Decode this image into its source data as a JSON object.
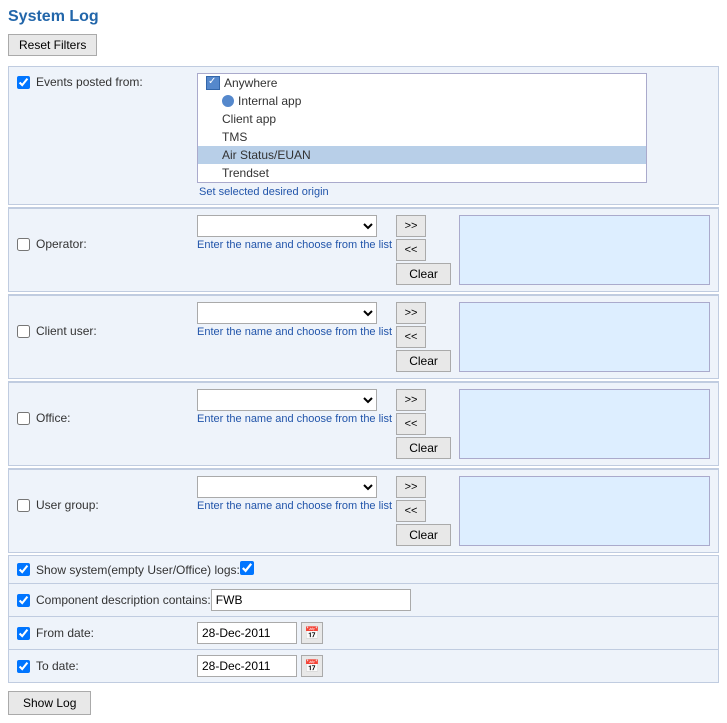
{
  "page": {
    "title": "System Log",
    "reset_button": "Reset Filters",
    "show_log_button": "Show Log"
  },
  "events_posted_from": {
    "label": "Events posted from:",
    "hint": "Set selected desired origin",
    "options": [
      {
        "id": "anywhere",
        "label": "Anywhere",
        "type": "checkbox",
        "selected": true,
        "indent": 0
      },
      {
        "id": "internal_app",
        "label": "Internal app",
        "type": "radio",
        "selected": true,
        "indent": 1
      },
      {
        "id": "client_app",
        "label": "Client app",
        "type": "none",
        "selected": false,
        "indent": 1
      },
      {
        "id": "tms",
        "label": "TMS",
        "type": "none",
        "selected": false,
        "indent": 1
      },
      {
        "id": "air_status",
        "label": "Air Status/EUAN",
        "type": "none",
        "selected": true,
        "indent": 1,
        "highlighted": true
      },
      {
        "id": "trendset",
        "label": "Trendset",
        "type": "none",
        "selected": false,
        "indent": 1
      }
    ]
  },
  "operator": {
    "label": "Operator:",
    "hint": "Enter the name and choose from the list",
    "add_label": ">>",
    "remove_label": "<<",
    "clear_label": "Clear",
    "value": ""
  },
  "client_user": {
    "label": "Client user:",
    "hint": "Enter the name and choose from the list",
    "add_label": ">>",
    "remove_label": "<<",
    "clear_label": "Clear",
    "value": ""
  },
  "office": {
    "label": "Office:",
    "hint": "Enter the name and choose from the list",
    "add_label": ">>",
    "remove_label": "<<",
    "clear_label": "Clear",
    "value": ""
  },
  "user_group": {
    "label": "User group:",
    "hint": "Enter the name and choose from the list",
    "add_label": ">>",
    "remove_label": "<<",
    "clear_label": "Clear",
    "value": ""
  },
  "show_system_logs": {
    "label": "Show system(empty User/Office) logs:",
    "checked": true
  },
  "component_description": {
    "label": "Component description contains:",
    "value": "FWB"
  },
  "from_date": {
    "label": "From date:",
    "value": "28-Dec-2011"
  },
  "to_date": {
    "label": "To date:",
    "value": "28-Dec-2011"
  }
}
